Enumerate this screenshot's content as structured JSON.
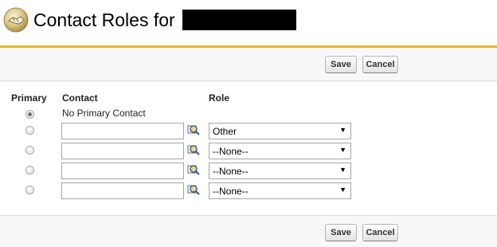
{
  "header": {
    "title": "Contact Roles for",
    "icon": "handshake-icon"
  },
  "toolbar_top": {
    "save_label": "Save",
    "cancel_label": "Cancel"
  },
  "toolbar_bottom": {
    "save_label": "Save",
    "cancel_label": "Cancel"
  },
  "table": {
    "columns": {
      "primary": "Primary",
      "contact": "Contact",
      "role": "Role"
    },
    "no_primary_label": "No Primary Contact",
    "rows": [
      {
        "primary_checked": false,
        "contact": "",
        "role": "Other"
      },
      {
        "primary_checked": false,
        "contact": "",
        "role": "--None--"
      },
      {
        "primary_checked": false,
        "contact": "",
        "role": "--None--"
      },
      {
        "primary_checked": false,
        "contact": "",
        "role": "--None--"
      }
    ]
  },
  "colors": {
    "accent_border": "#e3b830",
    "panel_bg": "#f8f8f8"
  }
}
